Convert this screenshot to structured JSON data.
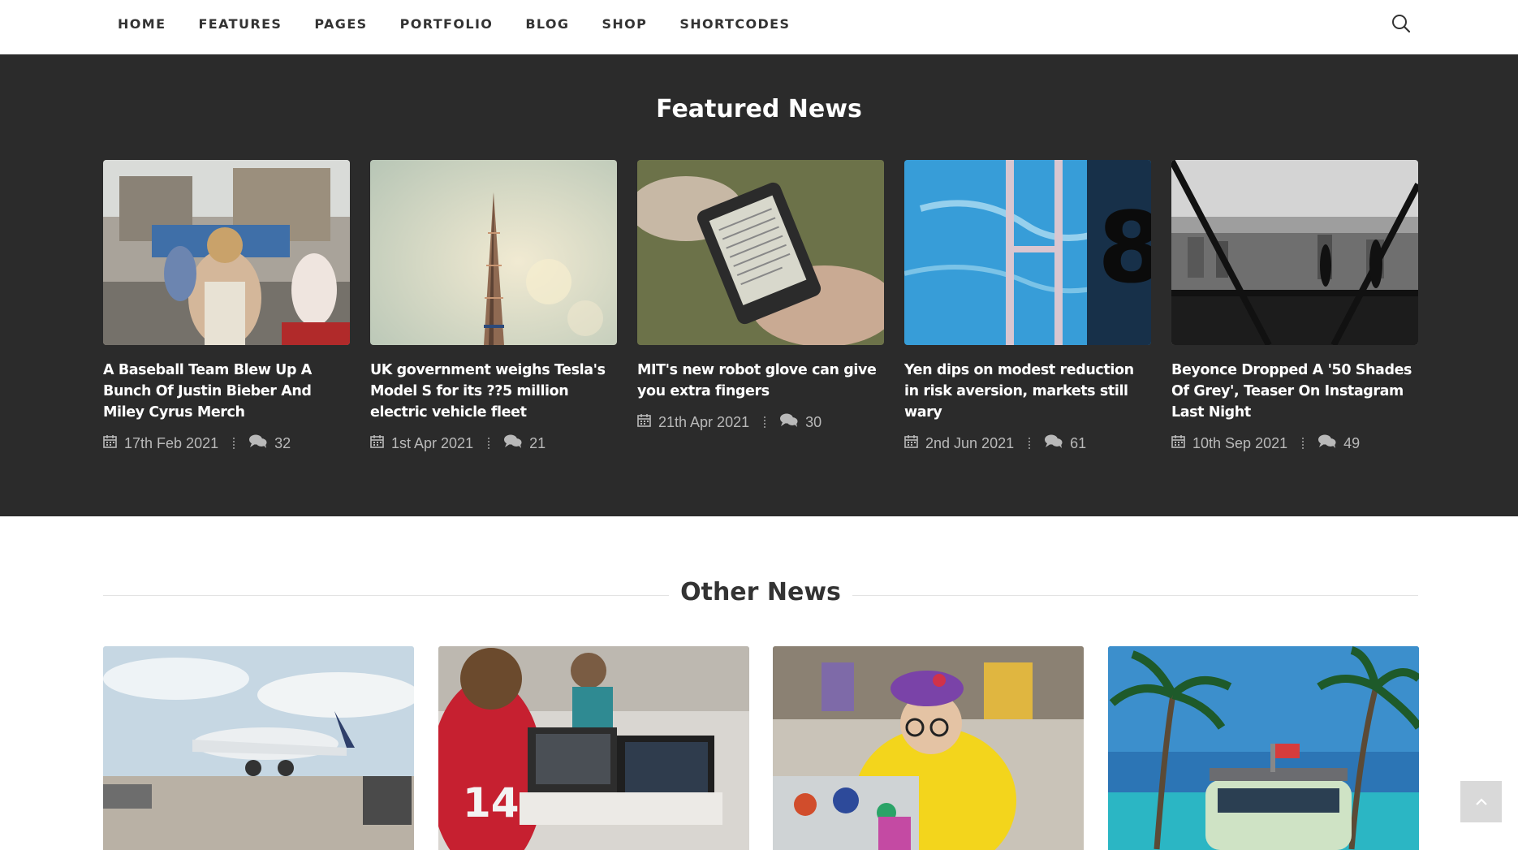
{
  "nav": {
    "items": [
      "HOME",
      "FEATURES",
      "PAGES",
      "PORTFOLIO",
      "BLOG",
      "SHOP",
      "SHORTCODES"
    ],
    "search_icon": "search-icon"
  },
  "featured": {
    "title": "Featured News",
    "articles": [
      {
        "title": "A Baseball Team Blew Up A Bunch Of Justin Bieber And Miley Cyrus Merch",
        "date": "17th Feb 2021",
        "comments": "32"
      },
      {
        "title": "UK government weighs Tesla's Model S for its ??5 million electric vehicle fleet",
        "date": "1st Apr 2021",
        "comments": "21"
      },
      {
        "title": "MIT's new robot glove can give you extra fingers",
        "date": "21th Apr 2021",
        "comments": "30"
      },
      {
        "title": "Yen dips on modest reduction in risk aversion, markets still wary",
        "date": "2nd Jun 2021",
        "comments": "61"
      },
      {
        "title": "Beyonce Dropped A '50 Shades Of Grey', Teaser On Instagram Last Night",
        "date": "10th Sep 2021",
        "comments": "49"
      }
    ]
  },
  "other": {
    "title": "Other News"
  },
  "icons": {
    "date": "calendar-icon",
    "comments": "comments-icon",
    "back_to_top": "chevron-up-icon"
  },
  "colors": {
    "featured_bg": "#2b2b2b",
    "meta_text": "#b9b9b9",
    "back_to_top_bg": "#d9d9d9"
  }
}
